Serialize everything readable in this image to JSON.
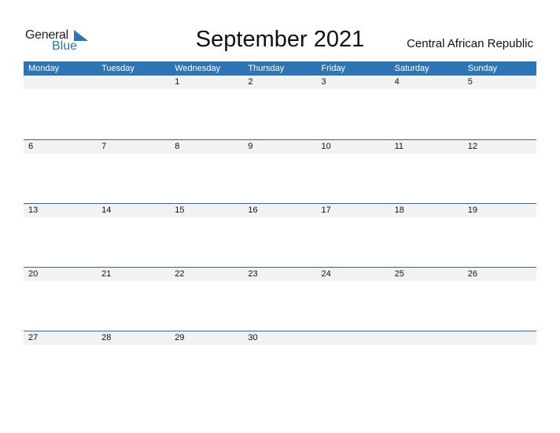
{
  "logo": {
    "part1": "General",
    "part2": "Blue"
  },
  "title": "September 2021",
  "country": "Central African Republic",
  "weekdays": [
    "Monday",
    "Tuesday",
    "Wednesday",
    "Thursday",
    "Friday",
    "Saturday",
    "Sunday"
  ],
  "weeks": [
    [
      "",
      "",
      "1",
      "2",
      "3",
      "4",
      "5"
    ],
    [
      "6",
      "7",
      "8",
      "9",
      "10",
      "11",
      "12"
    ],
    [
      "13",
      "14",
      "15",
      "16",
      "17",
      "18",
      "19"
    ],
    [
      "20",
      "21",
      "22",
      "23",
      "24",
      "25",
      "26"
    ],
    [
      "27",
      "28",
      "29",
      "30",
      "",
      "",
      ""
    ]
  ],
  "colors": {
    "accent": "#2e75b6",
    "strip": "#f2f2f2"
  }
}
